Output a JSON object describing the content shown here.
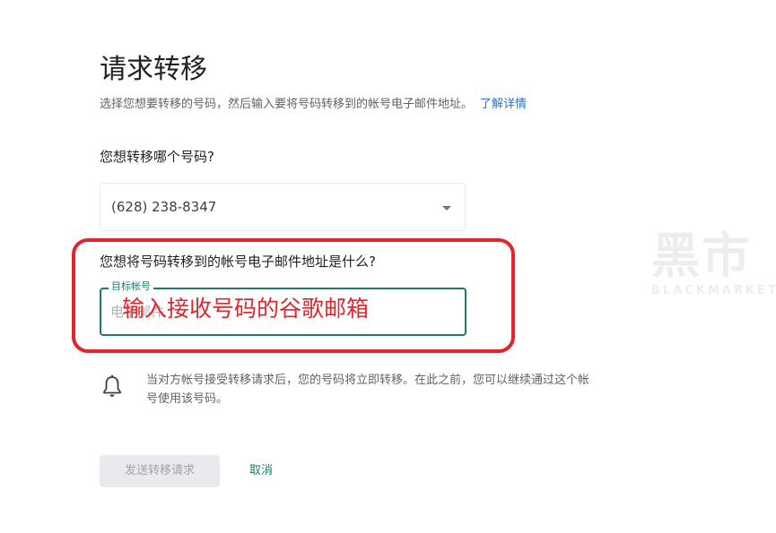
{
  "header": {
    "title": "请求转移",
    "subtitle": "选择您想要转移的号码，然后输入要将号码转移到的帐号电子邮件地址。",
    "learn_more": "了解详情"
  },
  "number_section": {
    "question": "您想转移哪个号码?",
    "selected_number": "(628) 238-8347"
  },
  "email_section": {
    "question": "您想将号码转移到的帐号电子邮件地址是什么?",
    "field_label": "目标帐号",
    "placeholder": "电子邮件",
    "value": ""
  },
  "annotation": {
    "text": "输入接收号码的谷歌邮箱",
    "color": "#e3242b"
  },
  "notice": {
    "icon": "bell-icon",
    "text": "当对方帐号接受转移请求后，您的号码将立即转移。在此之前，您可以继续通过这个帐号使用该号码。"
  },
  "actions": {
    "send_label": "发送转移请求",
    "cancel_label": "取消"
  },
  "watermark": {
    "logo_text": "黑市",
    "logo_sub": "BLACKMARKET"
  },
  "colors": {
    "accent": "#1f7a6c",
    "link": "#1a73e8",
    "annotation_red": "#e3242b",
    "disabled_bg": "#e8eaed"
  }
}
